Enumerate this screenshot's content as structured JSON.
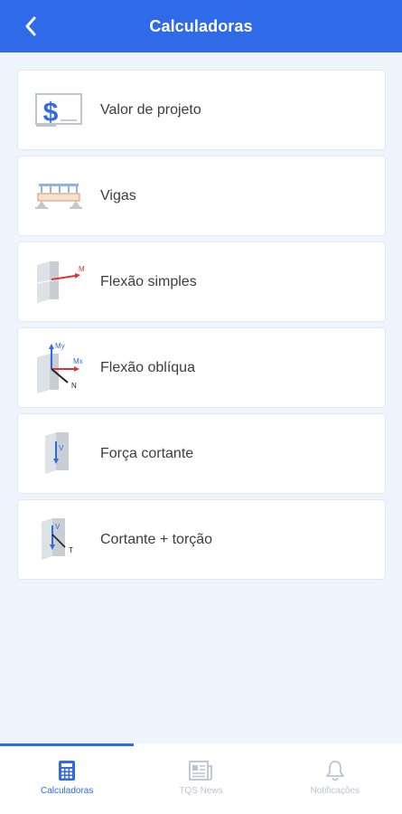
{
  "header": {
    "title": "Calculadoras"
  },
  "calculators": [
    {
      "label": "Valor de projeto",
      "icon": "dollar-sign-icon"
    },
    {
      "label": "Vigas",
      "icon": "beam-icon"
    },
    {
      "label": "Flexão simples",
      "icon": "simple-bending-icon"
    },
    {
      "label": "Flexão oblíqua",
      "icon": "oblique-bending-icon"
    },
    {
      "label": "Força cortante",
      "icon": "shear-force-icon"
    },
    {
      "label": "Cortante + torção",
      "icon": "shear-torsion-icon"
    }
  ],
  "icon_text": {
    "moment": "M",
    "moment_y": "My",
    "moment_x": "Mx",
    "normal": "N",
    "shear": "V",
    "torsion": "T"
  },
  "bottom_nav": [
    {
      "label": "Calculadoras",
      "icon": "calculator-icon",
      "active": true
    },
    {
      "label": "TQS News",
      "icon": "newspaper-icon",
      "active": false
    },
    {
      "label": "Notificações",
      "icon": "bell-icon",
      "active": false
    }
  ],
  "colors": {
    "primary": "#2f6ae8",
    "background": "#eef5fd",
    "card": "#ffffff",
    "text": "#3d3d3d",
    "inactive_nav": "#b9c4d2",
    "moment_red": "#d9343a"
  }
}
